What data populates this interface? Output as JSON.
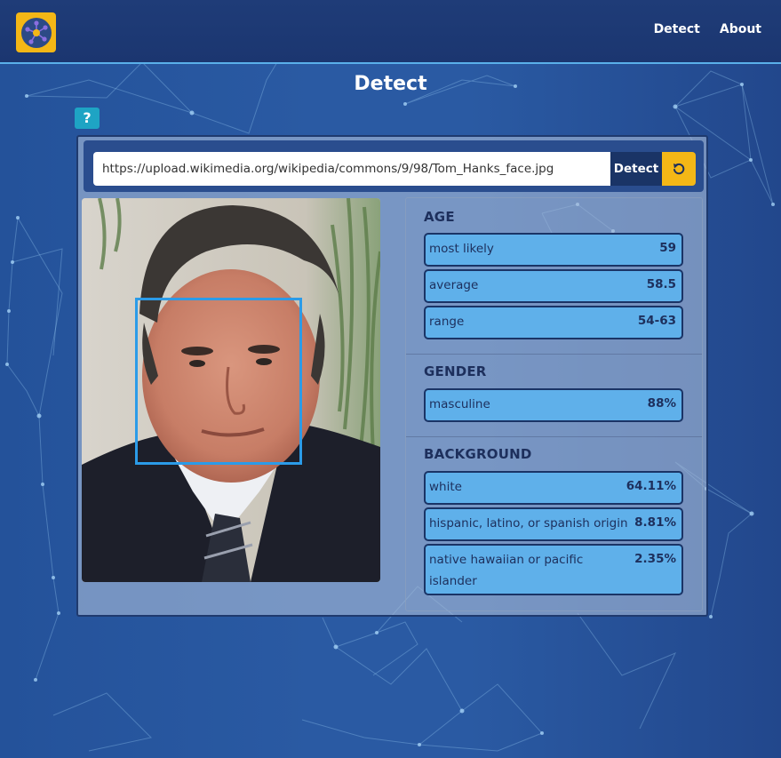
{
  "nav": {
    "links": [
      "Detect",
      "About"
    ]
  },
  "page": {
    "title": "Detect",
    "help_label": "?"
  },
  "search": {
    "url": "https://upload.wikimedia.org/wikipedia/commons/9/98/Tom_Hanks_face.jpg",
    "detect_label": "Detect",
    "reset_icon": "reset-icon"
  },
  "results": {
    "age": {
      "title": "AGE",
      "rows": [
        {
          "label": "most likely",
          "value": "59"
        },
        {
          "label": "average",
          "value": "58.5"
        },
        {
          "label": "range",
          "value": "54-63"
        }
      ]
    },
    "gender": {
      "title": "GENDER",
      "rows": [
        {
          "label": "masculine",
          "value": "88%"
        }
      ]
    },
    "background": {
      "title": "BACKGROUND",
      "rows": [
        {
          "label": "white",
          "value": "64.11%"
        },
        {
          "label": "hispanic, latino, or spanish origin",
          "value": "8.81%"
        },
        {
          "label": "native hawaiian or pacific islander",
          "value": "2.35%"
        }
      ]
    }
  },
  "colors": {
    "accent": "#f4b716",
    "navbar": "#1f3c78",
    "row_fill": "#5fb0ea",
    "face_box": "#2b9be8",
    "help": "#1ea4c4"
  }
}
